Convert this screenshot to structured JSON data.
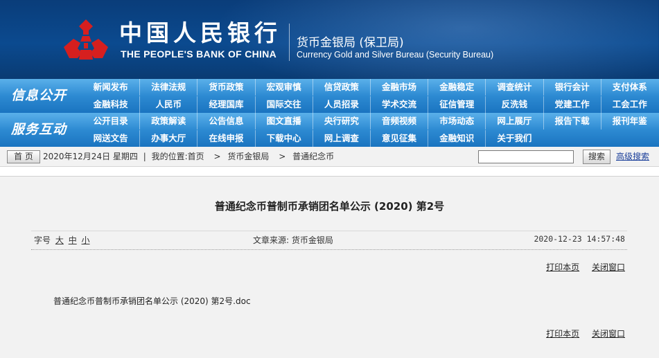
{
  "header": {
    "bank_cn": "中国人民银行",
    "bank_en": "THE PEOPLE'S BANK OF CHINA",
    "bureau_cn": "货币金银局 (保卫局)",
    "bureau_en": "Currency Gold and Silver Bureau (Security Bureau)",
    "logo_icon": "pboc-logo-icon",
    "logo_color": "#d61f1f",
    "bg_color": "#0b4a8f"
  },
  "nav": {
    "section1_label": "信息公开",
    "section2_label": "服务互动",
    "rows": [
      [
        "新闻发布",
        "法律法规",
        "货币政策",
        "宏观审慎",
        "信贷政策",
        "金融市场",
        "金融稳定",
        "调查统计",
        "银行会计",
        "支付体系"
      ],
      [
        "金融科技",
        "人民币",
        "经理国库",
        "国际交往",
        "人员招录",
        "学术交流",
        "征信管理",
        "反洗钱",
        "党建工作",
        "工会工作"
      ],
      [
        "公开目录",
        "政策解读",
        "公告信息",
        "图文直播",
        "央行研究",
        "音频视频",
        "市场动态",
        "网上展厅",
        "报告下载",
        "报刊年鉴"
      ],
      [
        "网送文告",
        "办事大厅",
        "在线申报",
        "下载中心",
        "网上调查",
        "意见征集",
        "金融知识",
        "关于我们"
      ]
    ],
    "nav_color": "#2d8ad2"
  },
  "breadcrumb": {
    "home": "首 页",
    "date": "2020年12月24日 星期四",
    "sep": "|",
    "location_label": "我的位置:",
    "path": [
      "首页",
      "货币金银局",
      "普通纪念币"
    ],
    "arrow": ">",
    "search_button": "搜索",
    "advanced_search": "高级搜索"
  },
  "article": {
    "title": "普通纪念币普制币承销团名单公示 (2020) 第2号",
    "font_size_label": "字号",
    "font_sizes": [
      "大",
      "中",
      "小"
    ],
    "source": "文章来源: 货币金银局",
    "time": "2020-12-23 14:57:48",
    "print": "打印本页",
    "close": "关闭窗口",
    "attachment": "普通纪念币普制币承销团名单公示 (2020) 第2号.doc"
  }
}
